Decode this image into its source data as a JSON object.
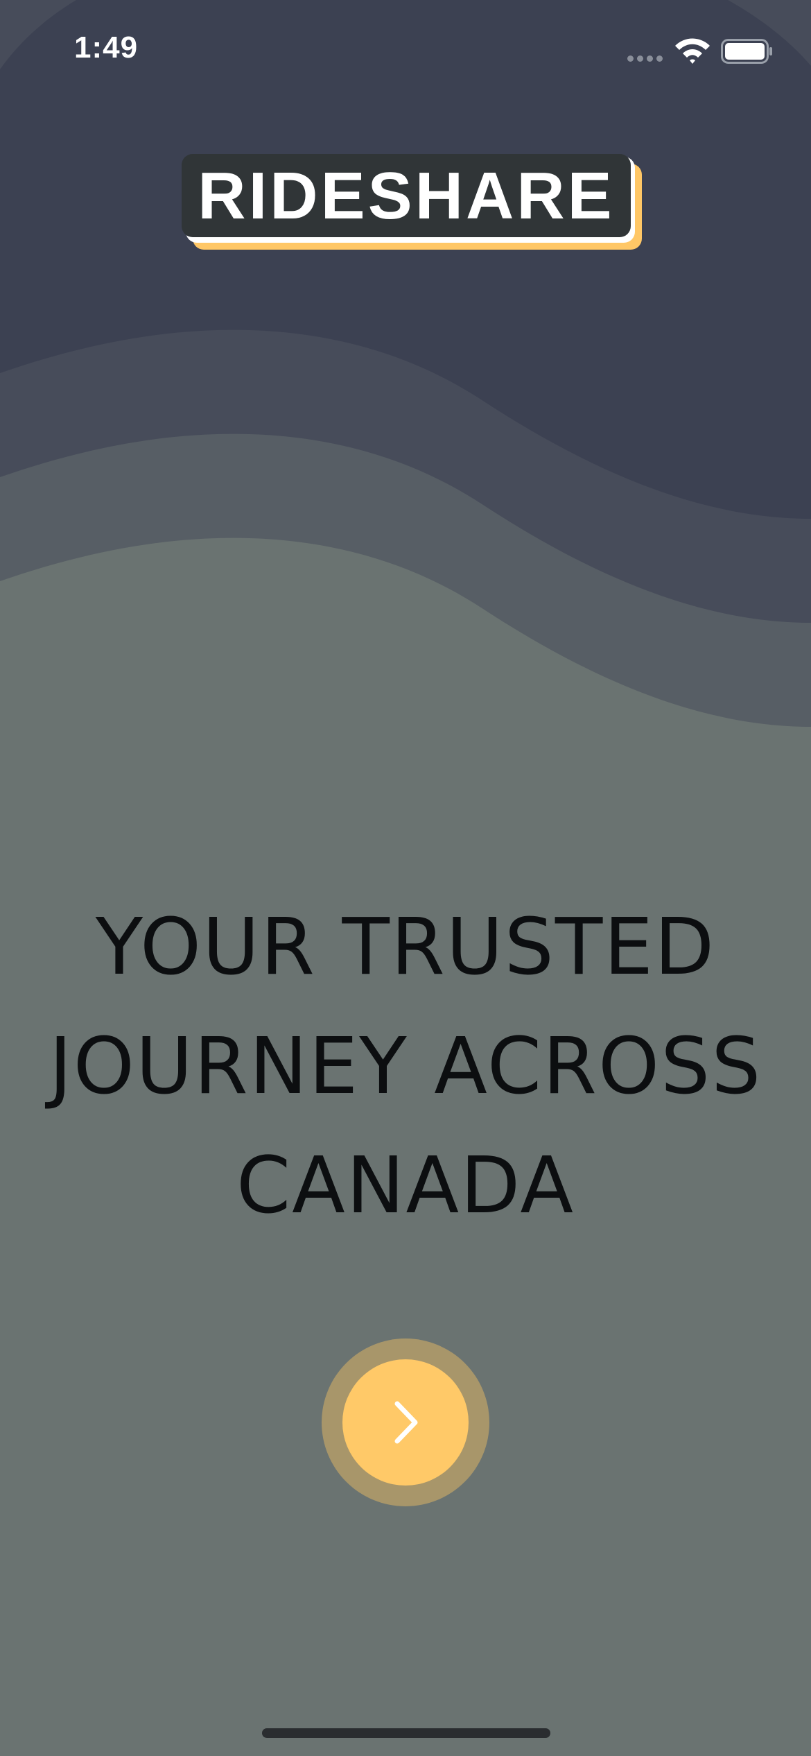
{
  "status_bar": {
    "time": "1:49"
  },
  "logo": {
    "text": "RIDESHARE"
  },
  "tagline": {
    "line1": "YOUR TRUSTED",
    "line2": "JOURNEY ACROSS",
    "line3": "CANADA"
  },
  "next_button": {
    "icon": "chevron-right-icon"
  },
  "icons": {
    "signal": "signal-icon",
    "wifi": "wifi-icon",
    "battery": "battery-icon"
  },
  "colors": {
    "background": "#6a7371",
    "wave_top": "#3c4152",
    "wave_mid": "#474c5a",
    "wave_low": "#575e65",
    "accent": "#ffc968",
    "accent_ring": "#a8966a",
    "logo_box": "#303537"
  }
}
